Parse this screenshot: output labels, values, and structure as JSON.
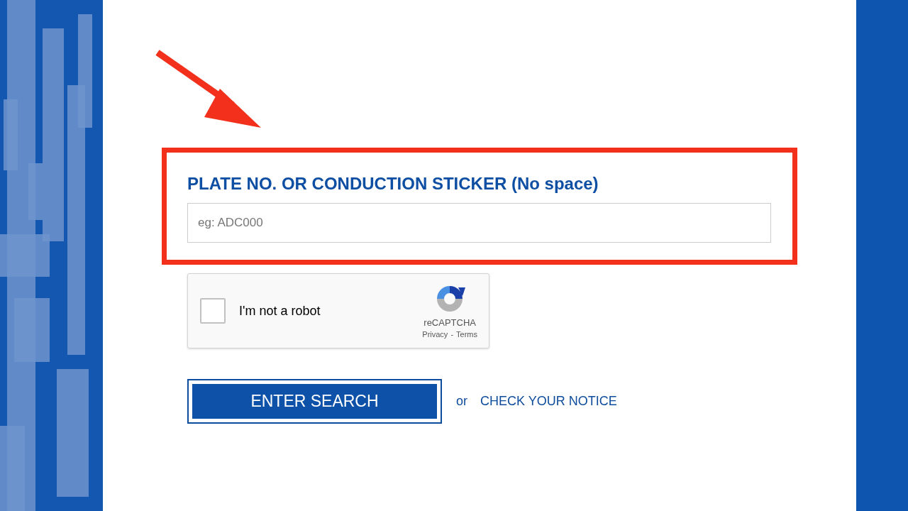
{
  "form": {
    "label": "PLATE NO. OR CONDUCTION STICKER (No space)",
    "placeholder": "eg: ADC000"
  },
  "captcha": {
    "label": "I'm not a robot",
    "checked": false,
    "brand": "reCAPTCHA",
    "links": [
      "Privacy",
      "Terms"
    ],
    "separator": "-"
  },
  "search_button": "ENTER SEARCH",
  "or_text": "or",
  "notice_link": "CHECK YOUR NOTICE"
}
